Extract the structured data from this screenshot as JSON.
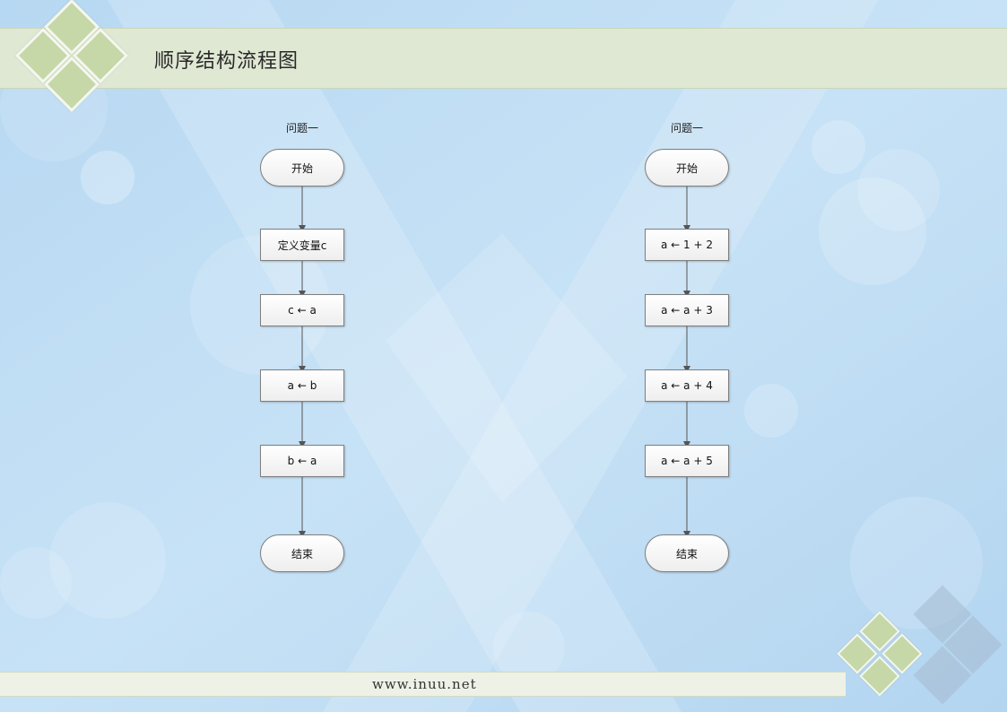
{
  "header": {
    "title": "顺序结构流程图"
  },
  "footer": {
    "url": "www.inuu.net"
  },
  "colors": {
    "background": "#bcdcf3",
    "header_band": "#dfe8d3",
    "diamond": "#c6d7a8",
    "connector": "#555555"
  },
  "flowcharts": [
    {
      "title": "问题一",
      "start": "开始",
      "steps": [
        "定义变量c",
        "c ← a",
        "a ← b",
        "b ← a"
      ],
      "end": "结束"
    },
    {
      "title": "问题一",
      "start": "开始",
      "steps": [
        "a ← 1 + 2",
        "a ← a + 3",
        "a ← a + 4",
        "a ← a + 5"
      ],
      "end": "结束"
    }
  ]
}
